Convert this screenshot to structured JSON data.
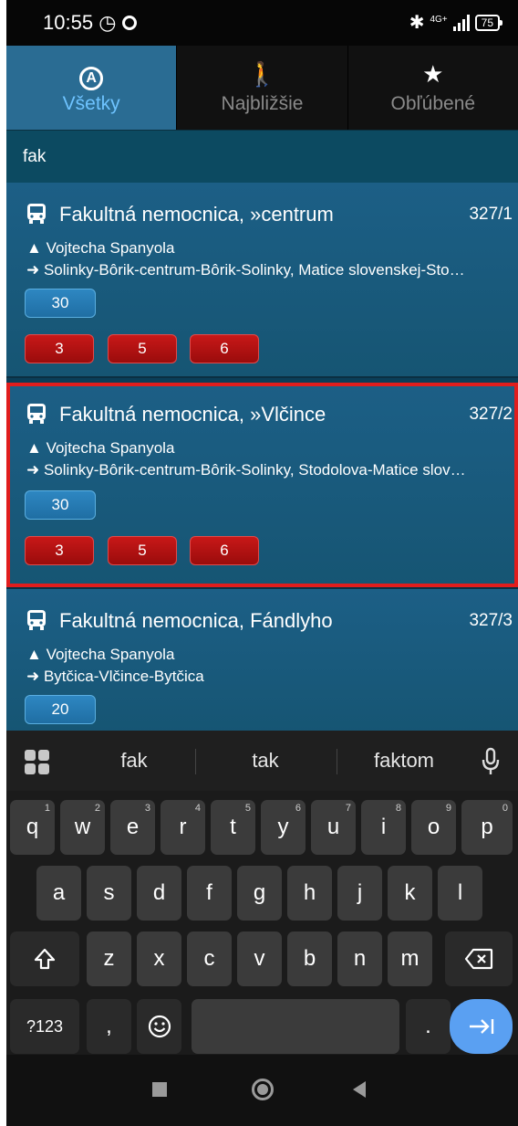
{
  "status_bar": {
    "time": "10:55",
    "alarm_icon": "alarm-icon",
    "circle_icon": "circle-icon",
    "bluetooth_icon": "bluetooth-icon",
    "network": "4G+",
    "battery": "75"
  },
  "tabs": [
    {
      "label": "Všetky",
      "icon": "circle-a-icon",
      "active": true
    },
    {
      "label": "Najbližšie",
      "icon": "walker-icon",
      "active": false
    },
    {
      "label": "Obľúbené",
      "icon": "star-icon",
      "active": false
    }
  ],
  "search": {
    "value": "fak"
  },
  "results": [
    {
      "name": "Fakultná nemocnica, »centrum",
      "code": "327/1",
      "street": "Vojtecha Spanyola",
      "route": "Solinky-Bôrik-centrum-Bôrik-Solinky, Matice slovenskej-Sto…",
      "blue_lines": [
        "30"
      ],
      "red_lines": [
        "3",
        "5",
        "6"
      ]
    },
    {
      "name": "Fakultná nemocnica, »Vlčince",
      "code": "327/2",
      "street": "Vojtecha Spanyola",
      "route": "Solinky-Bôrik-centrum-Bôrik-Solinky, Stodolova-Matice slov…",
      "blue_lines": [
        "30"
      ],
      "red_lines": [
        "3",
        "5",
        "6"
      ]
    },
    {
      "name": "Fakultná nemocnica, Fándlyho",
      "code": "327/3",
      "street": "Vojtecha Spanyola",
      "route": "Bytčica-Vlčince-Bytčica",
      "blue_lines": [
        "20"
      ],
      "red_lines": []
    }
  ],
  "keyboard": {
    "suggestions": [
      "fak",
      "tak",
      "faktom"
    ],
    "row1": [
      "q",
      "w",
      "e",
      "r",
      "t",
      "y",
      "u",
      "i",
      "o",
      "p"
    ],
    "row1_nums": [
      "1",
      "2",
      "3",
      "4",
      "5",
      "6",
      "7",
      "8",
      "9",
      "0"
    ],
    "row2": [
      "a",
      "s",
      "d",
      "f",
      "g",
      "h",
      "j",
      "k",
      "l"
    ],
    "row3": [
      "z",
      "x",
      "c",
      "v",
      "b",
      "n",
      "m"
    ],
    "symbols_label": "?123",
    "comma": ",",
    "period": ".",
    "shift_icon": "shift-icon",
    "backspace_icon": "backspace-icon",
    "emoji_icon": "emoji-icon",
    "enter_icon": "tab-right-icon"
  },
  "colors": {
    "active_tab": "#2a6c93",
    "card_blue": "#1c5f86",
    "line_blue": "#2e87c2",
    "line_red": "#c81818",
    "highlight": "#e11d1d",
    "enter_key": "#5aa0f2"
  }
}
